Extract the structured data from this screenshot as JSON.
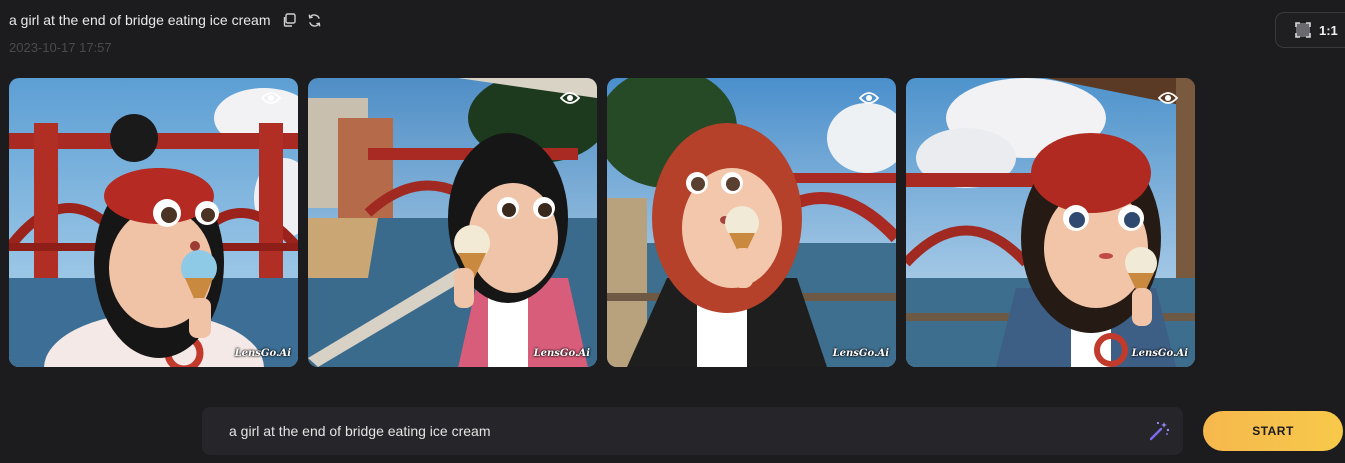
{
  "header": {
    "prompt_title": "a girl at the end of bridge eating ice cream",
    "timestamp": "2023-10-17 17:57",
    "copy_icon": "copy-icon",
    "regenerate_icon": "refresh-icon"
  },
  "ratio_chip": {
    "label": "1:1",
    "icon": "aspect-ratio-icon"
  },
  "images": [
    {
      "alt": "girl with red beanie and bun eating ice cream near red bridge",
      "watermark": "LensGo.Ai",
      "view_icon": "eye-icon"
    },
    {
      "alt": "girl with black hair in pink jacket eating ice cream near red bridge",
      "watermark": "LensGo.Ai",
      "view_icon": "eye-icon"
    },
    {
      "alt": "red-haired girl in black jacket eating ice cream near red bridge",
      "watermark": "LensGo.Ai",
      "view_icon": "eye-icon"
    },
    {
      "alt": "girl with red beanie in denim jacket eating ice cream near red bridge",
      "watermark": "LensGo.Ai",
      "view_icon": "eye-icon"
    }
  ],
  "prompt_bar": {
    "value": "a girl at the end of bridge eating ice cream",
    "magic_icon": "magic-wand-icon",
    "start_label": "START"
  },
  "colors": {
    "background": "#1c1c1e",
    "accent_start": "#f6b84d",
    "accent_end": "#f7c94a",
    "wand": "#7c6cf0"
  }
}
